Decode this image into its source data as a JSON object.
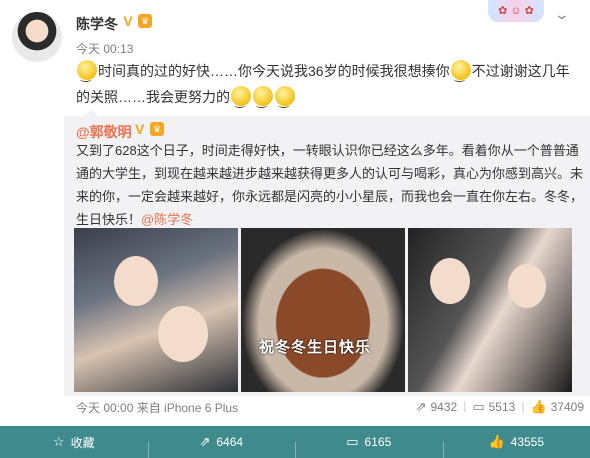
{
  "post": {
    "username": "陈学冬",
    "time": "今天 00:13",
    "text_parts": [
      "时间真的过的好快……你今天说我36岁的时候我很想揍你",
      "不过谢谢这几年的关照……我会更努力的"
    ]
  },
  "retweet": {
    "author": "@郭敬明",
    "text_main": "又到了628这个日子，时间走得好快，一转眼认识你已经这么多年。看着你从一个普普通通的大学生，到现在越来越进步越来越获得更多人的认可与喝彩，真心为你感到高兴。未来的你，一定会越来越好，你永远都是闪亮的小小星辰，而我也会一直在你左右。冬冬，生日快乐！",
    "mention": "@陈学冬",
    "cake_caption": "祝冬冬生日快乐",
    "meta": "今天 00:00 来自 iPhone 6 Plus",
    "stats": {
      "reposts": "9432",
      "comments": "5513",
      "likes": "37409"
    }
  },
  "bottombar": {
    "favorite": "收藏",
    "repost": "6464",
    "comment": "6165",
    "like": "43555"
  },
  "icons": {
    "favorite": "star-icon",
    "repost": "repost-icon",
    "comment": "comment-icon",
    "like": "thumbs-up-icon"
  },
  "colors": {
    "accent": "#eb7350",
    "background": "#3f8a8c"
  }
}
